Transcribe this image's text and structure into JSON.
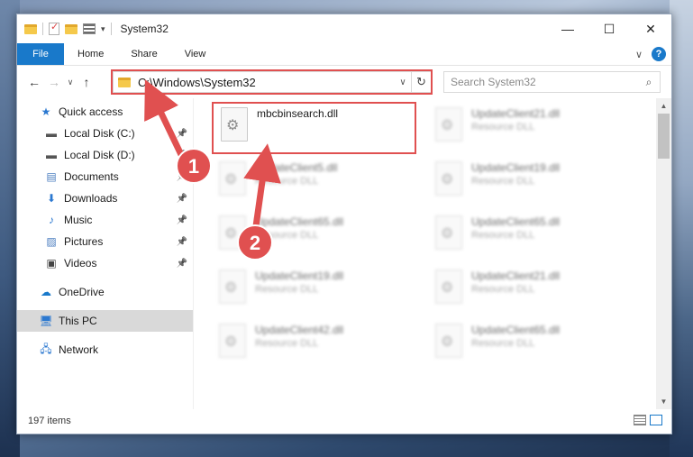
{
  "window": {
    "title": "System32",
    "controls": {
      "minimize": "—",
      "maximize": "☐",
      "close": "✕"
    }
  },
  "ribbon": {
    "tabs": [
      "File",
      "Home",
      "Share",
      "View"
    ],
    "help": "?"
  },
  "navbar": {
    "back": "←",
    "forward": "→",
    "recent": "∨",
    "up": "↑",
    "address": "C:\\Windows\\System32",
    "refresh": "↻",
    "search_placeholder": "Search System32",
    "search_icon": "⌕"
  },
  "sidebar": {
    "items": [
      {
        "label": "Quick access",
        "icon": "star-icon",
        "glyph": "★",
        "color": "#2b78d0",
        "pinned": false
      },
      {
        "label": "Local Disk (C:)",
        "icon": "drive-icon",
        "glyph": "▬",
        "color": "#555555",
        "pinned": true
      },
      {
        "label": "Local Disk (D:)",
        "icon": "drive-icon",
        "glyph": "▬",
        "color": "#555555",
        "pinned": true
      },
      {
        "label": "Documents",
        "icon": "documents-icon",
        "glyph": "▤",
        "color": "#4d7fc0",
        "pinned": true
      },
      {
        "label": "Downloads",
        "icon": "download-icon",
        "glyph": "⬇",
        "color": "#2b78d0",
        "pinned": true
      },
      {
        "label": "Music",
        "icon": "music-icon",
        "glyph": "♪",
        "color": "#2b78d0",
        "pinned": true
      },
      {
        "label": "Pictures",
        "icon": "pictures-icon",
        "glyph": "▨",
        "color": "#4d7fc0",
        "pinned": true
      },
      {
        "label": "Videos",
        "icon": "videos-icon",
        "glyph": "▣",
        "color": "#444444",
        "pinned": true
      },
      {
        "label": "OneDrive",
        "icon": "cloud-icon",
        "glyph": "☁",
        "color": "#1979ca",
        "pinned": false
      },
      {
        "label": "This PC",
        "icon": "computer-icon",
        "glyph": "🖥",
        "color": "#2b78d0",
        "pinned": false,
        "selected": true
      },
      {
        "label": "Network",
        "icon": "network-icon",
        "glyph": "🖧",
        "color": "#2b78d0",
        "pinned": false
      }
    ]
  },
  "files": {
    "highlighted": {
      "name": "mbcbinsearch.dll",
      "type": ""
    },
    "blurred": [
      {
        "name": "UpdateClient21.dll",
        "type": "Resource DLL"
      },
      {
        "name": "UpdateClient5.dll",
        "type": "Resource DLL"
      },
      {
        "name": "UpdateClient19.dll",
        "type": "Resource DLL"
      },
      {
        "name": "UpdateClient65.dll",
        "type": "Resource DLL"
      },
      {
        "name": "UpdateClient65.dll",
        "type": "Resource DLL"
      },
      {
        "name": "UpdateClient19.dll",
        "type": "Resource DLL"
      },
      {
        "name": "UpdateClient21.dll",
        "type": "Resource DLL"
      },
      {
        "name": "UpdateClient42.dll",
        "type": "Resource DLL"
      },
      {
        "name": "UpdateClient65.dll",
        "type": "Resource DLL"
      }
    ]
  },
  "status": {
    "count": "197 items"
  },
  "annotations": {
    "step1": "1",
    "step2": "2",
    "color": "#e05050"
  }
}
